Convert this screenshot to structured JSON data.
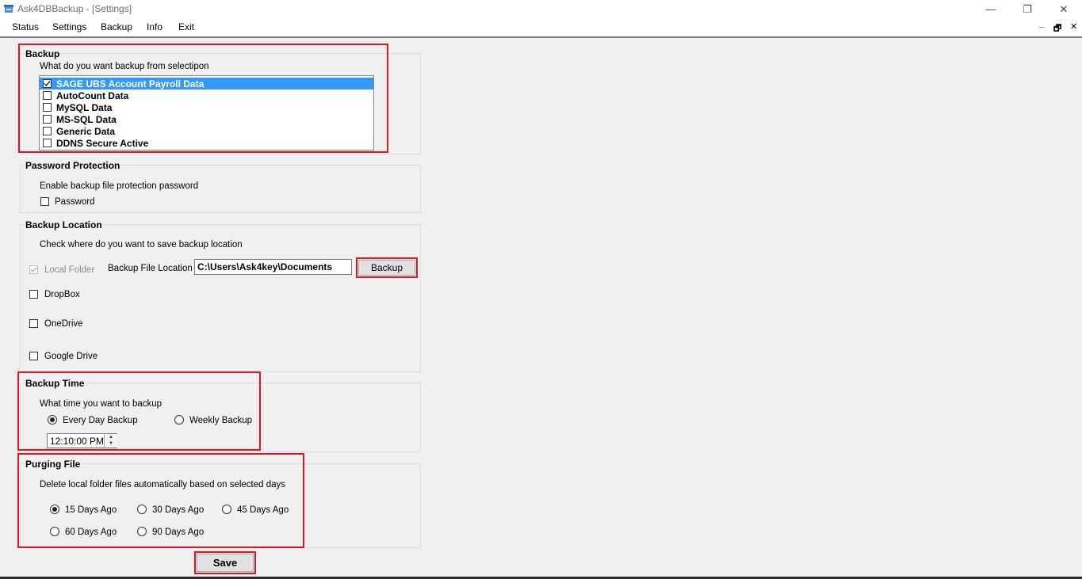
{
  "window": {
    "title": "Ask4DBBackup - [Settings]",
    "minimize_glyph": "—",
    "restore_glyph": "❐",
    "close_glyph": "✕"
  },
  "menu": {
    "items": [
      "Status",
      "Settings",
      "Backup",
      "Info",
      "Exit"
    ],
    "mdi_minimize": "_",
    "mdi_restore": "🗗",
    "mdi_close": "✕"
  },
  "backup": {
    "title": "Backup",
    "prompt": "What do you want backup from selectipon",
    "options": [
      {
        "label": "SAGE UBS Account Payroll Data",
        "checked": true,
        "selected": true
      },
      {
        "label": "AutoCount Data",
        "checked": false,
        "selected": false
      },
      {
        "label": "MySQL Data",
        "checked": false,
        "selected": false
      },
      {
        "label": "MS-SQL Data",
        "checked": false,
        "selected": false
      },
      {
        "label": "Generic Data",
        "checked": false,
        "selected": false
      },
      {
        "label": "DDNS Secure Active",
        "checked": false,
        "selected": false
      }
    ]
  },
  "password_protection": {
    "title": "Password Protection",
    "prompt": "Enable backup file protection password",
    "password_label": "Password",
    "password_checked": false
  },
  "backup_location": {
    "title": "Backup Location",
    "prompt": "Check  where do you want to save backup location",
    "local_folder_label": "Local Folder",
    "local_folder_checked": true,
    "file_location_label": "Backup File Location",
    "file_location_value": "C:\\Users\\Ask4key\\Documents",
    "browse_button": "Backup",
    "dropbox_label": "DropBox",
    "onedrive_label": "OneDrive",
    "googledrive_label": "Google Drive"
  },
  "backup_time": {
    "title": "Backup Time",
    "prompt": "What time you want to backup",
    "every_day_label": "Every Day Backup",
    "weekly_label": "Weekly Backup",
    "selected": "Every Day Backup",
    "time_value": "12:10:00 PM"
  },
  "purging": {
    "title": "Purging File",
    "prompt": "Delete local folder files automatically based on selected days",
    "options": [
      "15 Days Ago",
      "30 Days Ago",
      "45 Days Ago",
      "60 Days Ago",
      "90 Days Ago"
    ],
    "selected": "15 Days Ago"
  },
  "save_button": "Save",
  "colors": {
    "highlight": "#e1141e",
    "selection": "#3399ff",
    "background": "#f0f0f0"
  },
  "icons": {
    "app": "app-database-icon",
    "check": "checkmark-icon",
    "spin": "spin-up-down-icon"
  }
}
